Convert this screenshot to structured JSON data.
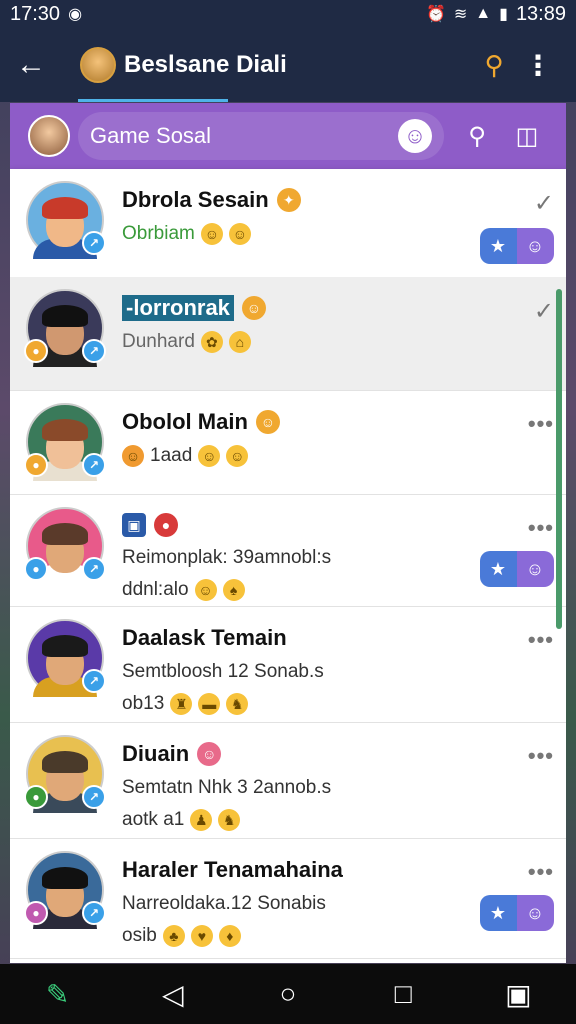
{
  "status_bar": {
    "time_left": "17:30",
    "time_right": "13:89"
  },
  "app_bar": {
    "title": "Beslsane Diali"
  },
  "group": {
    "name": "Game Sosal"
  },
  "chats": [
    {
      "name": "Dbrola Sesain",
      "line1": "Obrbiam",
      "line2": "",
      "meta": "check",
      "has_action": true,
      "colors": {
        "bg": "#6ab0e0",
        "hair": "#c83a2a",
        "body": "#2a5aa8",
        "skin": "#f0b888"
      }
    },
    {
      "name": "-lorronrak",
      "line1": "Dunhard",
      "line2": "",
      "meta": "check",
      "has_action": false,
      "colors": {
        "bg": "#3a3a5a",
        "hair": "#111111",
        "body": "#222222",
        "skin": "#d09870"
      }
    },
    {
      "name": "Obolol Main",
      "line1": "1aad",
      "line2": "",
      "meta": "dots",
      "has_action": false,
      "colors": {
        "bg": "#3a7a5a",
        "hair": "#8a4a2a",
        "body": "#e8e0d0",
        "skin": "#f0c098"
      }
    },
    {
      "name": "",
      "line1": "Reimonplak: 39amnobl:s",
      "line2": "ddnl:alo",
      "meta": "dots",
      "has_action": true,
      "colors": {
        "bg": "#e85a8a",
        "hair": "#5a3a2a",
        "body": "#ffffff",
        "skin": "#e0a878"
      }
    },
    {
      "name": "Daalask Temain",
      "line1": "Semtbloosh 12 Sonab.s",
      "line2": "ob13",
      "meta": "dots",
      "has_action": false,
      "colors": {
        "bg": "#5a3aa8",
        "hair": "#1a1a1a",
        "body": "#d8a020",
        "skin": "#e0a878"
      }
    },
    {
      "name": "Diuain",
      "line1": "Semtatn Nhk 3 2annob.s",
      "line2": "aotk a1",
      "meta": "dots",
      "has_action": false,
      "colors": {
        "bg": "#e8c050",
        "hair": "#4a3a2a",
        "body": "#3a4a5a",
        "skin": "#e0a878"
      }
    },
    {
      "name": "Haraler Tenamahaina",
      "line1": "Narreoldaka.12 Sonabis",
      "line2": "osib",
      "meta": "dots",
      "has_action": true,
      "colors": {
        "bg": "#3a6a9a",
        "hair": "#111111",
        "body": "#2a2a3a",
        "skin": "#e0a878"
      }
    }
  ],
  "icons": {
    "back": "arrow-left-icon",
    "search": "search-icon",
    "more": "more-vert-icon",
    "emoji": "emoji-icon",
    "camera": "camera-icon"
  }
}
